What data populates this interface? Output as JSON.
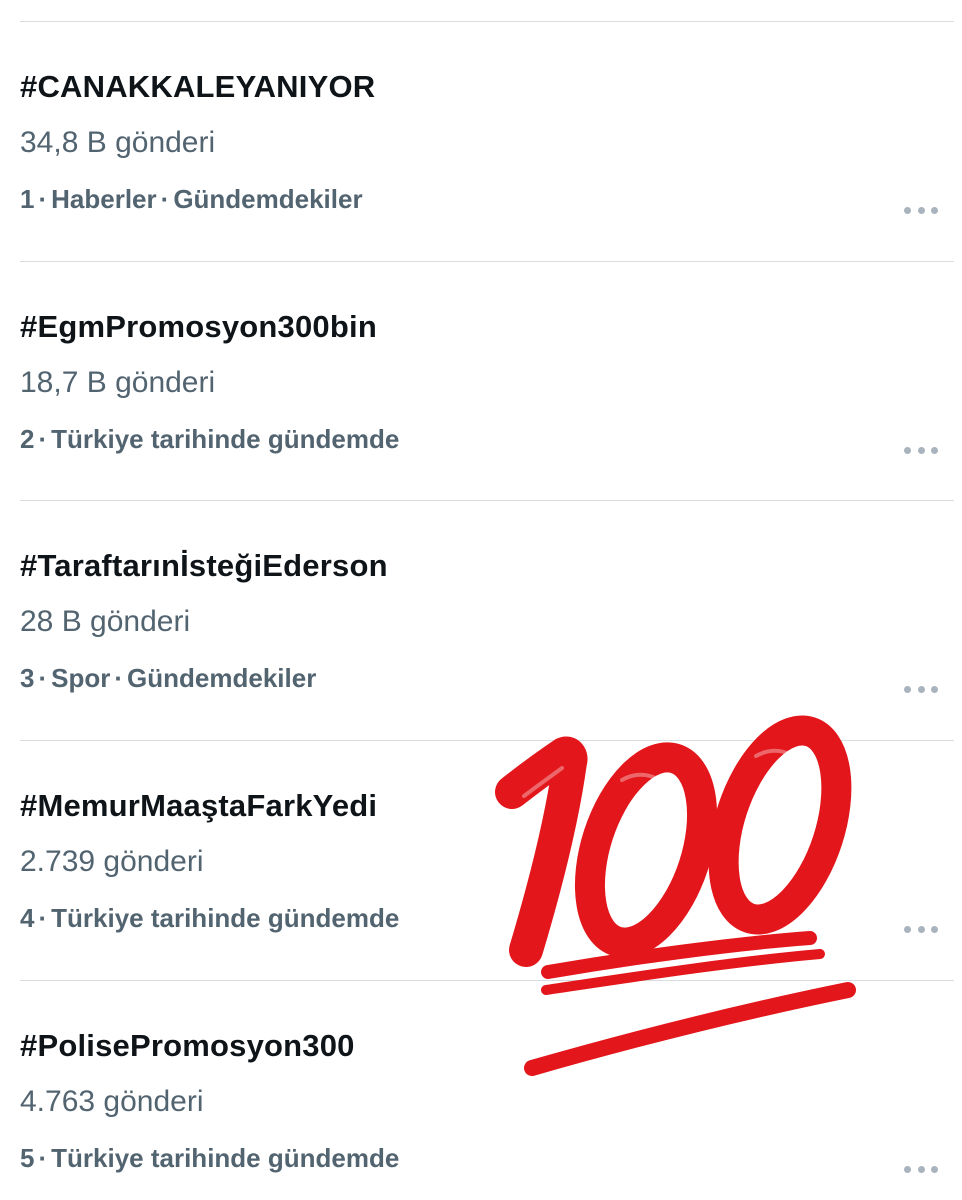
{
  "trends": [
    {
      "tag": "#CANAKKALEYANIYOR",
      "count": "34,8 B gönderi",
      "rank": "1",
      "category": "Haberler",
      "status": "Gündemdekiler"
    },
    {
      "tag": "#EgmPromosyon300bin",
      "count": "18,7 B gönderi",
      "rank": "2",
      "category": "",
      "status": "Türkiye tarihinde gündemde"
    },
    {
      "tag": "#TaraftarınİsteğiEderson",
      "count": "28 B gönderi",
      "rank": "3",
      "category": "Spor",
      "status": "Gündemdekiler"
    },
    {
      "tag": "#MemurMaaştaFarkYedi",
      "count": "2.739 gönderi",
      "rank": "4",
      "category": "",
      "status": "Türkiye tarihinde gündemde"
    },
    {
      "tag": "#PolisePromosyon300",
      "count": "4.763 gönderi",
      "rank": "5",
      "category": "",
      "status": "Türkiye tarihinde gündemde"
    }
  ],
  "overlay": {
    "emoji": "hundred-points-emoji",
    "color": "#e3161b"
  },
  "colors": {
    "primary_text": "#0f1419",
    "secondary_text": "#536471",
    "divider": "#d8dde2"
  }
}
